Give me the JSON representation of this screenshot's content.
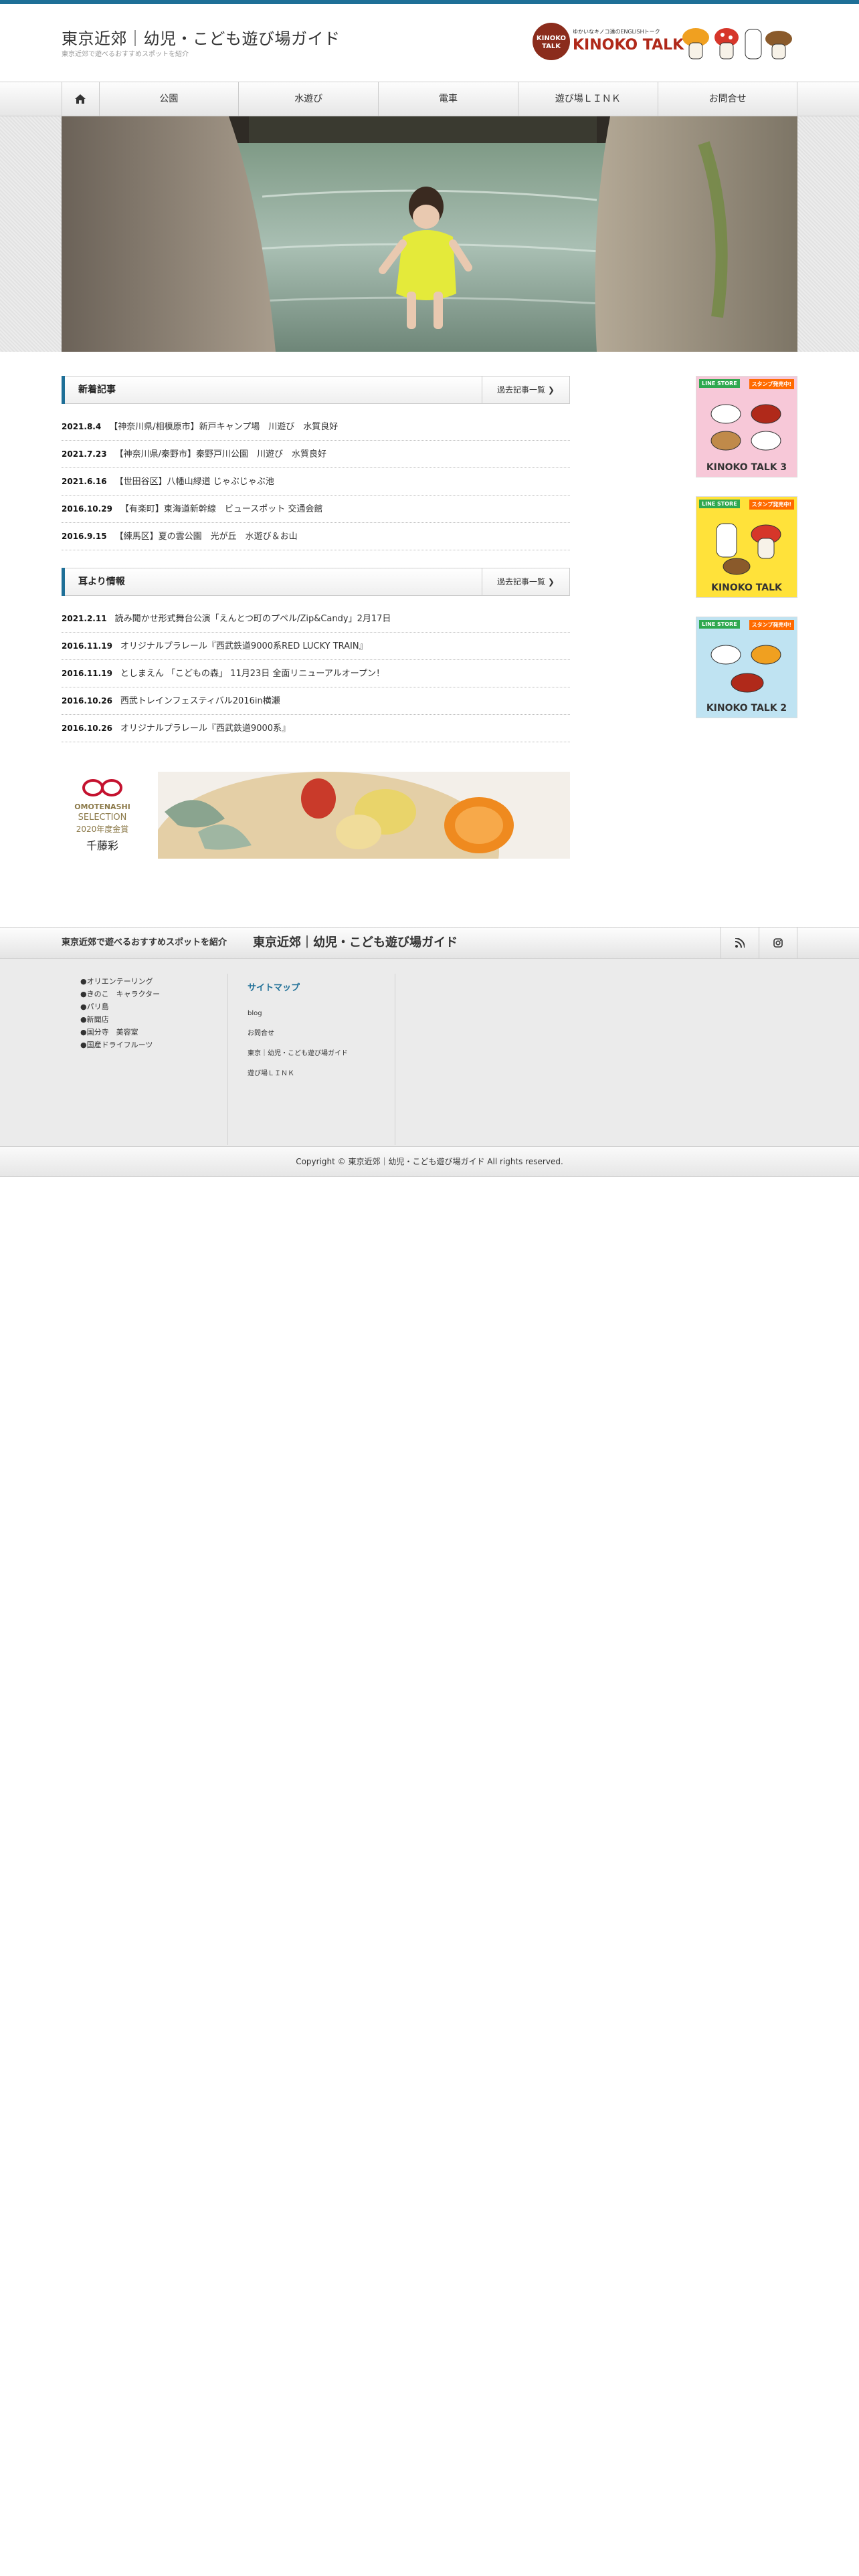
{
  "site": {
    "title": "東京近郊｜幼児・こども遊び場ガイド",
    "description": "東京近郊で遊べるおすすめスポットを紹介"
  },
  "header_banner": {
    "brand": "KINOKO TALK",
    "tagline": "ゆかいなキノコ達のENGLISHトーク"
  },
  "nav": {
    "home_icon": "home-icon",
    "items": [
      "公園",
      "水遊び",
      "電車",
      "遊び場ＬＩＮＫ",
      "お問合せ"
    ]
  },
  "new_posts": {
    "heading": "新着記事",
    "more": "過去記事一覧",
    "items": [
      {
        "date": "2021.8.4",
        "title": "【神奈川県/相模原市】新戸キャンプ場　川遊び　水質良好"
      },
      {
        "date": "2021.7.23",
        "title": "【神奈川県/秦野市】秦野戸川公園　川遊び　水質良好"
      },
      {
        "date": "2021.6.16",
        "title": "【世田谷区】八幡山緑道 じゃぶじゃぶ池"
      },
      {
        "date": "2016.10.29",
        "title": "【有楽町】東海道新幹線　ビュースポット 交通会館"
      },
      {
        "date": "2016.9.15",
        "title": "【練馬区】夏の雲公園　光が丘　水遊び＆お山"
      }
    ]
  },
  "info": {
    "heading": "耳より情報",
    "more": "過去記事一覧",
    "items": [
      {
        "date": "2021.2.11",
        "title": "読み聞かせ形式舞台公演「えんとつ町のプペル/Zip&Candy」2月17日"
      },
      {
        "date": "2016.11.19",
        "title": "オリジナルプラレール『西武鉄道9000系RED LUCKY TRAIN』"
      },
      {
        "date": "2016.11.19",
        "title": "としまえん 「こどもの森」 11月23日 全面リニューアルオープン！"
      },
      {
        "date": "2016.10.26",
        "title": "西武トレインフェスティバル2016in横瀬"
      },
      {
        "date": "2016.10.26",
        "title": "オリジナルプラレール『西武鉄道9000系』"
      }
    ]
  },
  "seal": {
    "line1": "OMOTENASHI",
    "line2": "SELECTION",
    "line3": "2020年度金賞",
    "line4": "千藤彩"
  },
  "stickers": [
    {
      "tag": "LINE STORE",
      "new": "スタンプ発売中!",
      "logo": "KINOKO TALK 3",
      "color": "#f7c8d8"
    },
    {
      "tag": "LINE STORE",
      "new": "スタンプ発売中!",
      "logo": "KINOKO TALK",
      "color": "#ffe23a"
    },
    {
      "tag": "LINE STORE",
      "new": "スタンプ発売中!",
      "logo": "KINOKO TALK 2",
      "color": "#bfe3f2"
    }
  ],
  "footer": {
    "desc": "東京近郊で遊べるおすすめスポットを紹介",
    "title": "東京近郊｜幼児・こども遊び場ガイド",
    "icons": [
      "rss-icon",
      "instagram-icon"
    ],
    "links": [
      "●オリエンテーリング",
      "●きのこ　キャラクター",
      "●パリ島",
      "●新聞店",
      "●国分寺　美容室",
      "●国産ドライフルーツ"
    ],
    "sitemap_heading": "サイトマップ",
    "sitemap": [
      "blog",
      "お問合せ",
      "東京｜幼児・こども遊び場ガイド",
      "遊び場ＬＩＮＫ"
    ],
    "copyright": "Copyright ©  東京近郊｜幼児・こども遊び場ガイド All rights reserved."
  },
  "colors": {
    "accent": "#1e6f97",
    "text": "#333333",
    "footer_bg": "#ebebeb"
  }
}
